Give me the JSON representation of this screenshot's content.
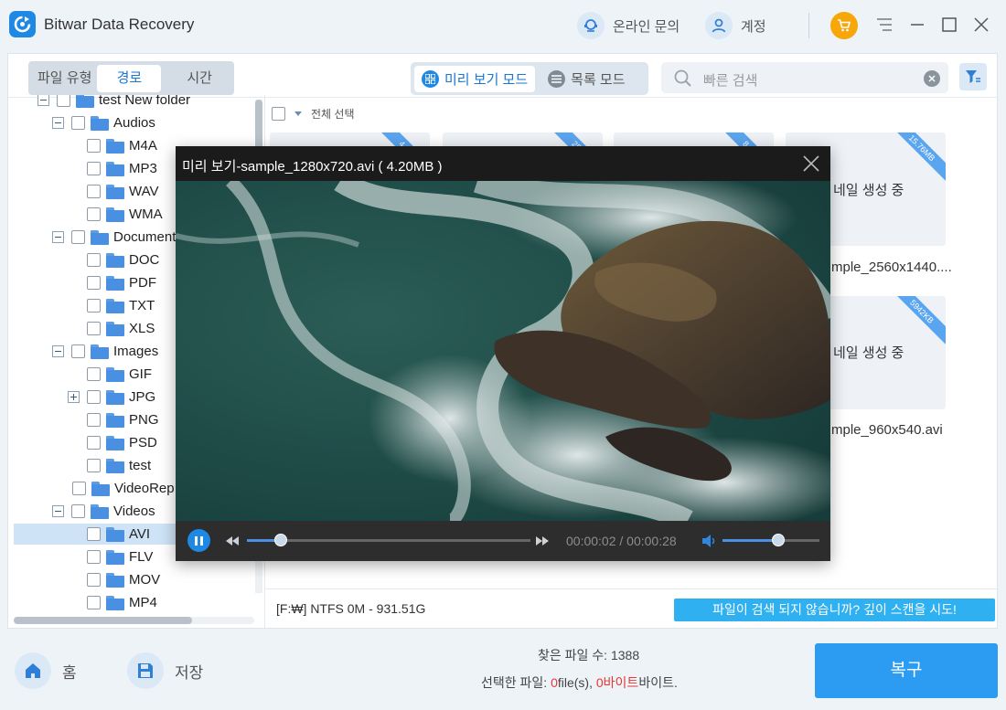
{
  "app": {
    "title": "Bitwar Data Recovery",
    "online_inquiry": "온라인 문의",
    "account": "계정"
  },
  "view_tabs": [
    "파일 유형",
    "경로",
    "시간"
  ],
  "modes": {
    "preview": "미리 보기 모드",
    "list": "목록 모드"
  },
  "search": {
    "placeholder": "빠른 검색"
  },
  "tree": {
    "root": "test New folder",
    "audios": "Audios",
    "m4a": "M4A",
    "mp3": "MP3",
    "wav": "WAV",
    "wma": "WMA",
    "documents": "Document",
    "doc": "DOC",
    "pdf": "PDF",
    "txt": "TXT",
    "xls": "XLS",
    "images": "Images",
    "gif": "GIF",
    "jpg": "JPG",
    "png": "PNG",
    "psd": "PSD",
    "test": "test",
    "videorep": "VideoRep",
    "videos": "Videos",
    "avi": "AVI",
    "flv": "FLV",
    "mov": "MOV",
    "mp4": "MP4"
  },
  "select_all": "전체 선택",
  "cards": [
    {
      "badge": "4.20"
    },
    {
      "badge": "25.9"
    },
    {
      "badge": "8.45"
    },
    {
      "badge": "15.76MB",
      "thumb": "네일 생성 중",
      "name": "mple_2560x1440...."
    },
    {
      "badge": "5942KB",
      "thumb": "네일 생성 중",
      "name": "mple_960x540.avi"
    }
  ],
  "disk_info": "[F:₩] NTFS 0M - 931.51G",
  "deep_scan": "파일이 검색 되지 않습니까? 깊이 스캔을 시도!",
  "preview": {
    "title": "미리 보기-sample_1280x720.avi ( 4.20MB )",
    "time": "00:00:02 / 00:00:28",
    "progress": 0.12,
    "volume": 0.58
  },
  "bottom": {
    "home": "홈",
    "save": "저장",
    "found_label": "찾은 파일 수: 1388",
    "selected_label": "선택한 파일: ",
    "sel_count": "0",
    "sel_unit": "file(s), ",
    "sel_bytes": "0바이트",
    "sel_tail": "바이트.",
    "recover": "복구"
  }
}
